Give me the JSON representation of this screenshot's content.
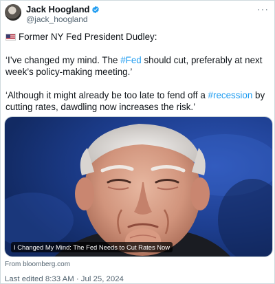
{
  "author": {
    "name": "Jack Hoogland",
    "handle": "@jack_hoogland",
    "verified_color": "#1d9bf0"
  },
  "menu": {
    "icon": "more-horizontal-icon",
    "label": "···"
  },
  "tweet": {
    "line1": "Former NY Fed President Dudley:",
    "quote1_pre": "‘I’ve changed my mind. The ",
    "quote1_tag": "#Fed",
    "quote1_post": " should cut, preferably at next week’s policy-making meeting.’",
    "quote2_pre": "‘Although it might already be too late to fend off a ",
    "quote2_tag": "#recession",
    "quote2_post": " by cutting rates, dawdling now increases the risk.’",
    "hashtag_color": "#1d9bf0"
  },
  "media": {
    "caption": "I Changed My Mind: The Fed Needs to Cut Rates Now",
    "source": "From bloomberg.com"
  },
  "footer": {
    "edited": "Last edited 8:33 AM · Jul 25, 2024"
  }
}
